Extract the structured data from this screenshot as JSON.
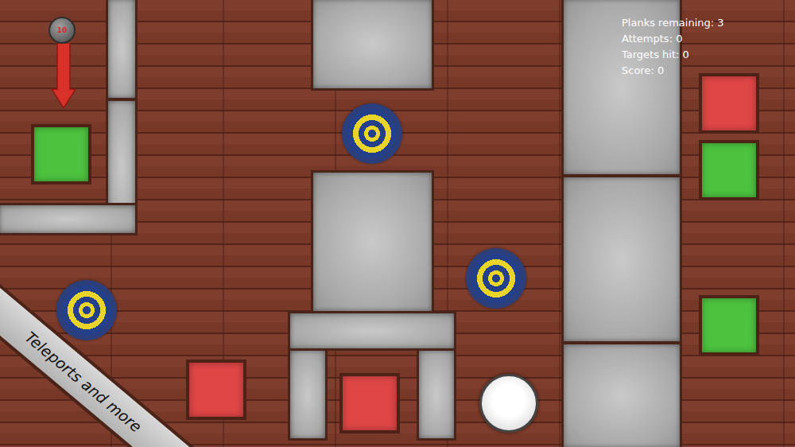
{
  "hud": [
    "Planks remaining: 3",
    "Attempts: 0",
    "Targets hit: 0",
    "Score: 0"
  ],
  "launcher": {
    "label": "10"
  },
  "banner": "Teleports and more",
  "tiles": [
    {
      "color": "#4cc23f"
    },
    {
      "color": "#df4646"
    },
    {
      "color": "#df4646"
    },
    {
      "color": "#df4646"
    },
    {
      "color": "#4cc23f"
    },
    {
      "color": "#4cc23f"
    }
  ]
}
